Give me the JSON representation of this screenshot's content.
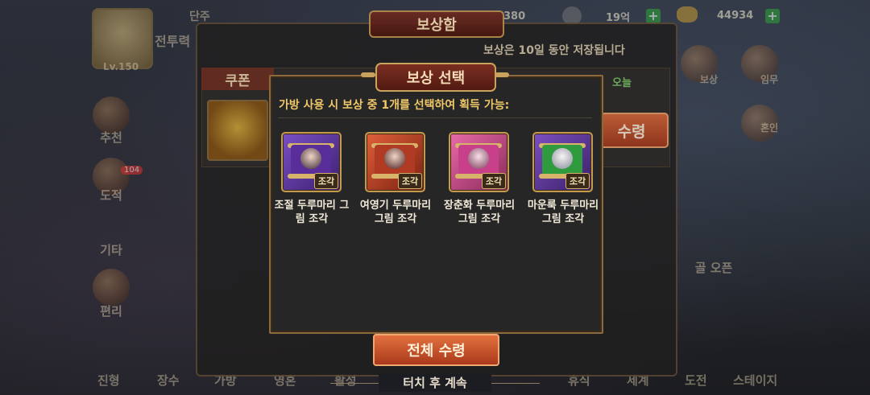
{
  "hud": {
    "level": "Lv.150",
    "power_label": "전투력",
    "top_label_a": "단주",
    "resource_a": "380",
    "resource_b": "19억",
    "resource_c": "44934"
  },
  "left_menu": [
    {
      "label": "추천"
    },
    {
      "label": "도적",
      "badge": "104"
    },
    {
      "label": "기타"
    },
    {
      "label": "편리"
    }
  ],
  "right_menu": [
    {
      "label": "보상"
    },
    {
      "label": "임무"
    },
    {
      "label": "혼인"
    },
    {
      "label": "골 오픈"
    }
  ],
  "bottom_nav": [
    "진형",
    "장수",
    "가방",
    "영혼",
    "활성",
    "휴식",
    "세계",
    "도전",
    "스테이지"
  ],
  "mailbox": {
    "title": "보상함",
    "notice": "보상은 10일 동안 저장됩니다",
    "coupon_tab": "쿠폰",
    "today": "오늘",
    "receive_button": "수령",
    "receive_all_button": "전체 수령",
    "touch_continue": "터치 후 계속"
  },
  "reward_dialog": {
    "title": "보상 선택",
    "instruction": "가방 사용 시 보상 중 1개를 선택하여 획득 가능:",
    "items": [
      {
        "name": "조절 두루마리 그림 조각",
        "tag": "조각",
        "color": "#6a3aa8",
        "icon": "scroll-purple-icon"
      },
      {
        "name": "여영기 두루마리 그림 조각",
        "tag": "조각",
        "color": "#c04a2a",
        "icon": "scroll-red-icon"
      },
      {
        "name": "장춘화 두루마리 그림 조각",
        "tag": "조각",
        "color": "#d2488a",
        "icon": "scroll-pink-icon"
      },
      {
        "name": "마운룩 두루마리 그림 조각",
        "tag": "조각",
        "color": "#3a9a3a",
        "icon": "scroll-green-icon"
      }
    ]
  }
}
